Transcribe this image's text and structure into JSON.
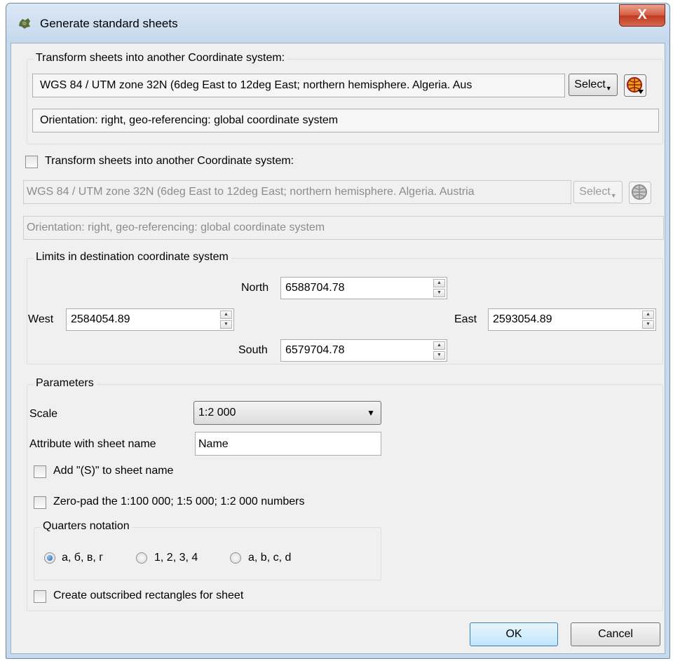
{
  "window": {
    "title": "Generate standard sheets",
    "close_label": "X"
  },
  "source_group": {
    "title": "Transform sheets into another Coordinate system:",
    "crs_value": "WGS 84 / UTM zone 32N (6deg East to 12deg East; northern hemisphere. Algeria. Aus",
    "select_label": "Select",
    "orientation_value": "Orientation: right, geo-referencing: global coordinate system"
  },
  "dest_section": {
    "checkbox_label": "Transform sheets into another Coordinate system:",
    "checked": false,
    "crs_value": "WGS 84 / UTM zone 32N (6deg East to 12deg East; northern hemisphere. Algeria. Austria",
    "select_label": "Select",
    "orientation_value": "Orientation: right, geo-referencing: global coordinate system"
  },
  "limits": {
    "title": "Limits in destination coordinate system",
    "north_label": "North",
    "north_value": "6588704.78",
    "west_label": "West",
    "west_value": "2584054.89",
    "east_label": "East",
    "east_value": "2593054.89",
    "south_label": "South",
    "south_value": "6579704.78"
  },
  "parameters": {
    "title": "Parameters",
    "scale_label": "Scale",
    "scale_value": "1:2 000",
    "attr_label": "Attribute with sheet name",
    "attr_value": "Name",
    "add_s_label": "Add \"(S)\" to sheet name",
    "zero_pad_label": "Zero-pad the 1:100 000; 1:5 000; 1:2 000 numbers",
    "quarters": {
      "title": "Quarters notation",
      "options": [
        "а, б, в, г",
        "1, 2, 3, 4",
        "a, b, c, d"
      ],
      "selected_index": 0
    },
    "outscribed_label": "Create outscribed rectangles for sheet"
  },
  "buttons": {
    "ok": "OK",
    "cancel": "Cancel"
  },
  "colors": {
    "title_bar": "#c5d8ec",
    "close_button": "#c8432a",
    "dialog_bg": "#f0f0f0",
    "ok_focus_border": "#3c7fb1"
  }
}
